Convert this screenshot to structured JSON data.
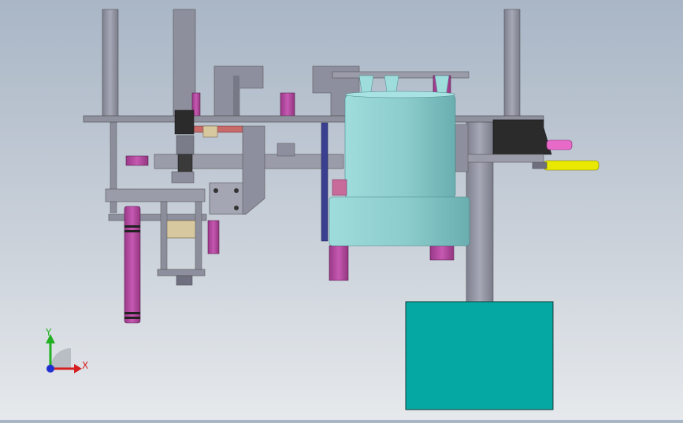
{
  "view": {
    "background_top": "#a9b6c6",
    "background_bottom": "#e6e9ec"
  },
  "colors": {
    "steel": "#8e8f9e",
    "steel_dark": "#5e6070",
    "steel_light": "#a4a6b4",
    "magenta": "#b3479f",
    "cyan_body": "#8fcfcf",
    "cyan_dark": "#6fb6b6",
    "teal_block": "#05a8a3",
    "black_part": "#2b2b2b",
    "yellow_pin": "#e8e800",
    "pink_pin": "#e86ac8",
    "navy_rail": "#3b3f8f",
    "tan_part": "#d8c8a0",
    "red_part": "#c86a6a"
  },
  "triad": {
    "x_label": "X",
    "y_label": "Y",
    "x_color": "#d42020",
    "y_color": "#20b020",
    "z_color": "#2030d0"
  }
}
